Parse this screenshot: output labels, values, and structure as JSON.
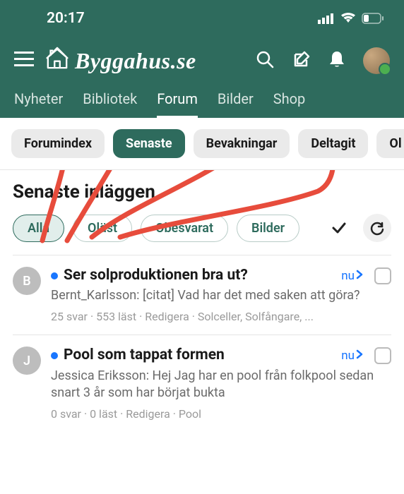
{
  "statusbar": {
    "time": "20:17"
  },
  "logo": {
    "text": "Byggahus.se"
  },
  "mainnav": [
    {
      "label": "Nyheter",
      "active": false
    },
    {
      "label": "Bibliotek",
      "active": false
    },
    {
      "label": "Forum",
      "active": true
    },
    {
      "label": "Bilder",
      "active": false
    },
    {
      "label": "Shop",
      "active": false
    }
  ],
  "subnav": [
    {
      "label": "Forumindex",
      "active": false
    },
    {
      "label": "Senaste",
      "active": true
    },
    {
      "label": "Bevakningar",
      "active": false
    },
    {
      "label": "Deltagit",
      "active": false
    },
    {
      "label": "Ol",
      "active": false
    }
  ],
  "page_title": "Senaste inläggen",
  "filters": [
    {
      "label": "Alla",
      "active": true
    },
    {
      "label": "Oläst",
      "active": false
    },
    {
      "label": "Obesvarat",
      "active": false
    },
    {
      "label": "Bilder",
      "active": false
    }
  ],
  "threads": [
    {
      "avatar": "B",
      "title": "Ser solproduktionen bra ut?",
      "time": "nu",
      "excerpt": "Bernt_Karlsson: [citat] Vad har det med saken att göra?",
      "meta": "25 svar · 553 läst · Redigera · Solceller, Solfångare, ..."
    },
    {
      "avatar": "J",
      "title": "Pool som tappat formen",
      "time": "nu",
      "excerpt": "Jessica Eriksson: Hej Jag har en pool från folkpool sedan snart 3 år som har börjat bukta",
      "meta": "0 svar · 0 läst · Redigera · Pool"
    }
  ]
}
